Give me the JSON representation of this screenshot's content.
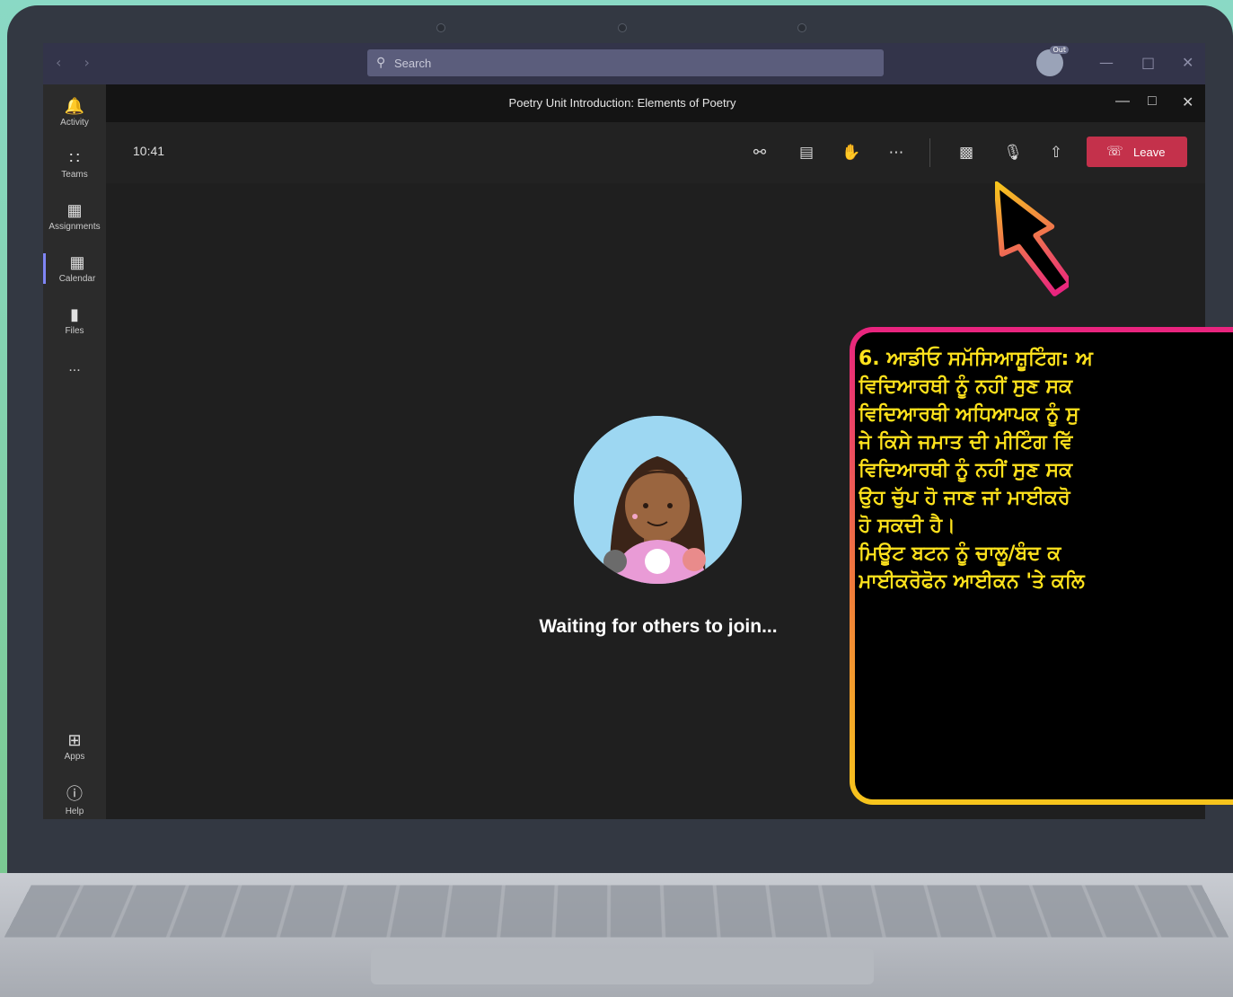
{
  "titlebar": {
    "search_placeholder": "Search",
    "avatar_badge": "Out"
  },
  "rail": {
    "items": [
      {
        "label": "Activity"
      },
      {
        "label": "Teams"
      },
      {
        "label": "Assignments"
      },
      {
        "label": "Calendar"
      },
      {
        "label": "Files"
      },
      {
        "label": "..."
      },
      {
        "label": "Apps"
      },
      {
        "label": "Help"
      }
    ]
  },
  "meeting": {
    "title": "Poetry Unit Introduction: Elements of Poetry",
    "time": "10:41",
    "leave_label": "Leave",
    "waiting_text": "Waiting for others to join..."
  },
  "callout": {
    "lines": [
      "6. ਆਡੀਓ ਸਮੱਸਿਆਸ਼ੂਟਿੰਗ: ਅ",
      "ਵਿਦਿਆਰਥੀ ਨੂੰ ਨਹੀਂ ਸੁਣ ਸਕ",
      "ਵਿਦਿਆਰਥੀ ਅਧਿਆਪਕ ਨੂੰ ਸੁ",
      "ਜੇ ਕਿਸੇ ਜਮਾਤ ਦੀ ਮੀਟਿੰਗ ਵਿੱ",
      "ਵਿਦਿਆਰਥੀ ਨੂੰ ਨਹੀਂ ਸੁਣ ਸਕ",
      "ਉਹ ਚੁੱਪ ਹੋ ਜਾਣ ਜਾਂ ਮਾਈਕਰੋ",
      "ਹੋ ਸਕਦੀ ਹੈ।",
      "ਮਿਊਟ ਬਟਨ ਨੂੰ ਚਾਲੂ/ਬੰਦ ਕ",
      "ਮਾਈਕਰੋਫੋਨ ਆਈਕਨ 'ਤੇ ਕਲਿ"
    ]
  },
  "colors": {
    "leave": "#c4314b",
    "callout_text": "#ffe21c",
    "accent": "#7f85f5"
  }
}
